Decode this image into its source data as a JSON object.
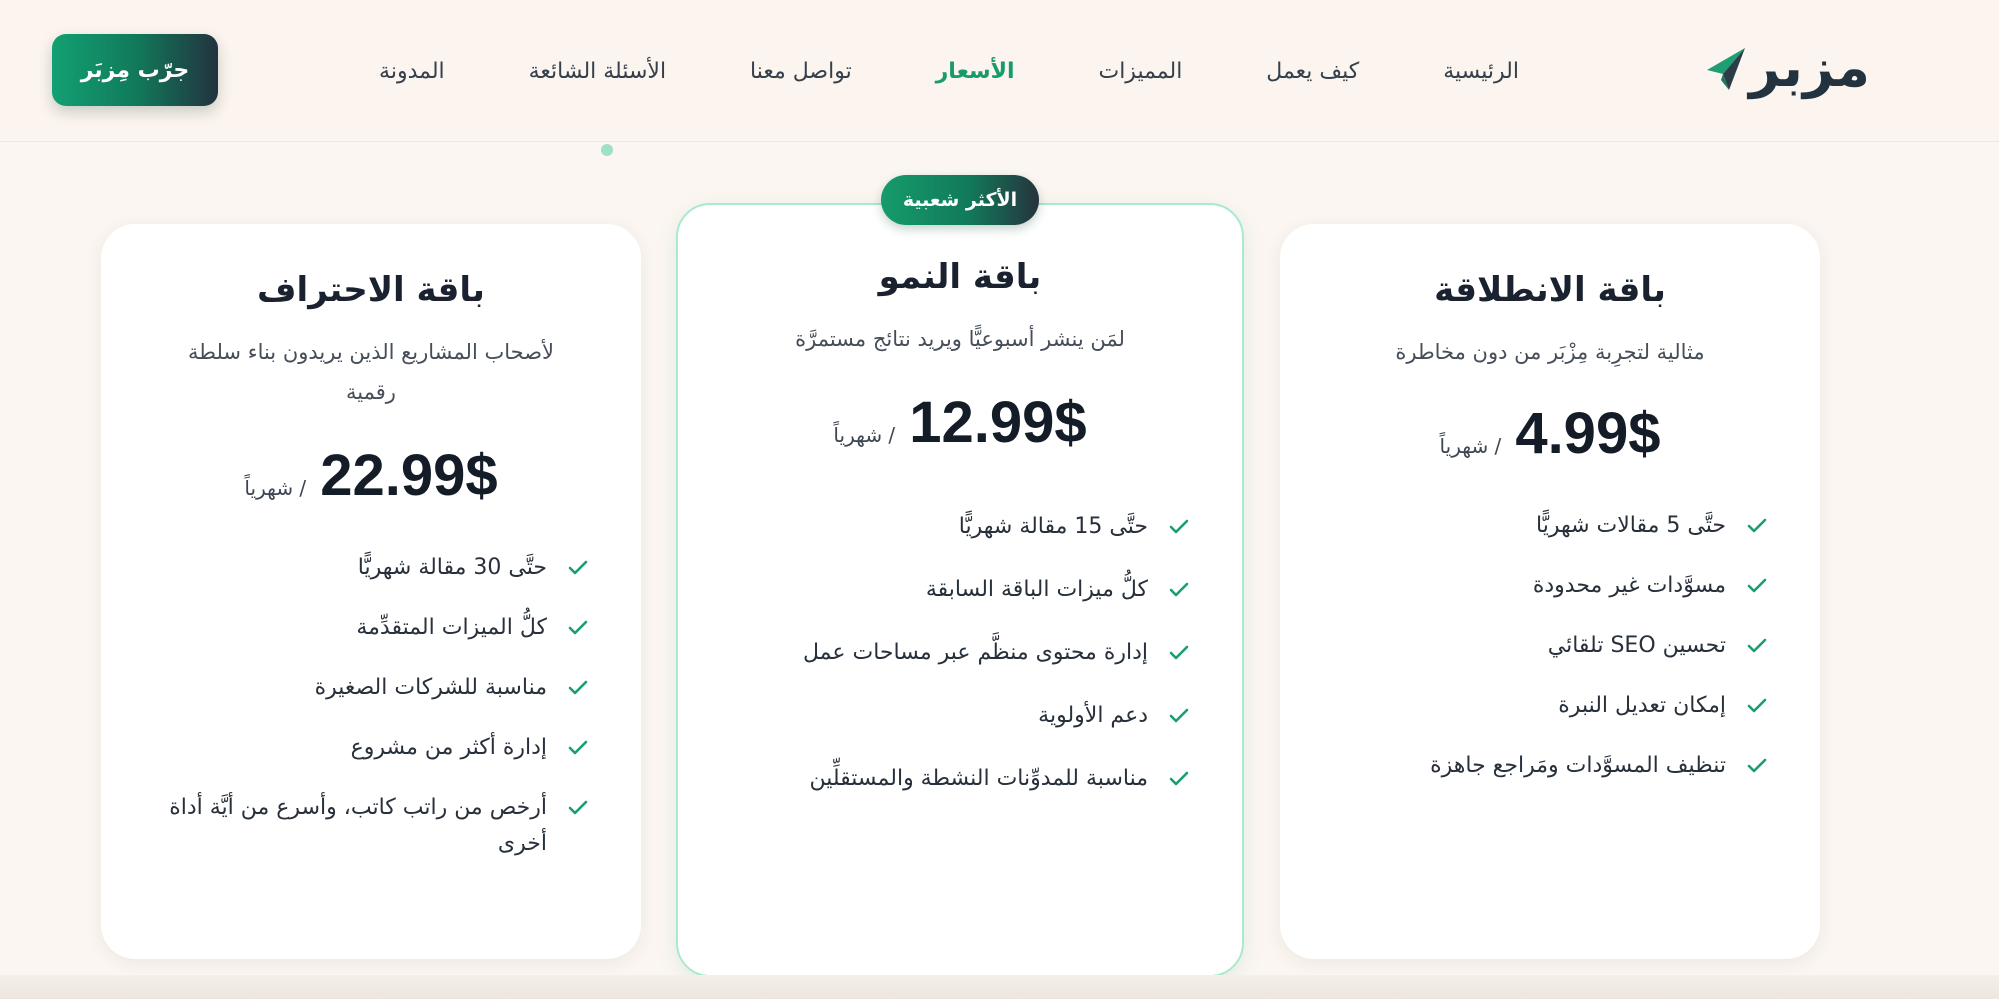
{
  "header": {
    "logo_text": "مزبر",
    "nav": [
      {
        "label": "الرئيسية"
      },
      {
        "label": "كيف يعمل"
      },
      {
        "label": "المميزات"
      },
      {
        "label": "الأسعار"
      },
      {
        "label": "تواصل معنا"
      },
      {
        "label": "الأسئلة الشائعة"
      },
      {
        "label": "المدونة"
      }
    ],
    "active_nav": "الأسعار",
    "cta_label": "جرّب مِزبَر"
  },
  "plans": [
    {
      "title": "باقة الانطلاقة",
      "description": "مثالية لتجرِبة مِزْبَر من دون مخاطرة",
      "price": "4.99$",
      "period": "/ شهرياً",
      "features": [
        "حتَّى 5 مقالات شهريًّا",
        "مسوَّدات غير محدودة",
        "تحسين SEO تلقائي",
        "إمكان تعديل النبرة",
        "تنظيف المسوَّدات ومَراجع جاهزة"
      ]
    },
    {
      "badge": "الأكثر شعبية",
      "title": "باقة النمو",
      "description": "لمَن ينشر أسبوعيًّا ويريد نتائج مستمرَّة",
      "price": "12.99$",
      "period": "/ شهرياً",
      "features": [
        "حتَّى 15 مقالة شهريًّا",
        "كلُّ ميزات الباقة السابقة",
        "إدارة محتوى منظَّم عبر مساحات عمل",
        "دعم الأولوية",
        "مناسبة للمدوِّنات النشطة والمستقلِّين"
      ]
    },
    {
      "title": "باقة الاحتراف",
      "description": "لأصحاب المشاريع الذين يريدون بناء سلطة رقمية",
      "price": "22.99$",
      "period": "/ شهرياً",
      "features": [
        "حتَّى 30 مقالة شهريًّا",
        "كلُّ الميزات المتقدِّمة",
        "مناسبة للشركات الصغيرة",
        "إدارة أكثر من مشروع",
        "أرخص من راتب كاتب، وأسرع من أيَّة أداة أخرى"
      ]
    }
  ],
  "colors": {
    "accent": "#169b6b",
    "dark": "#22333f",
    "background": "#fbf6f1",
    "check": "#1a9e70"
  },
  "icons": {
    "logo": "paper-plane-icon",
    "feature": "check-icon"
  }
}
